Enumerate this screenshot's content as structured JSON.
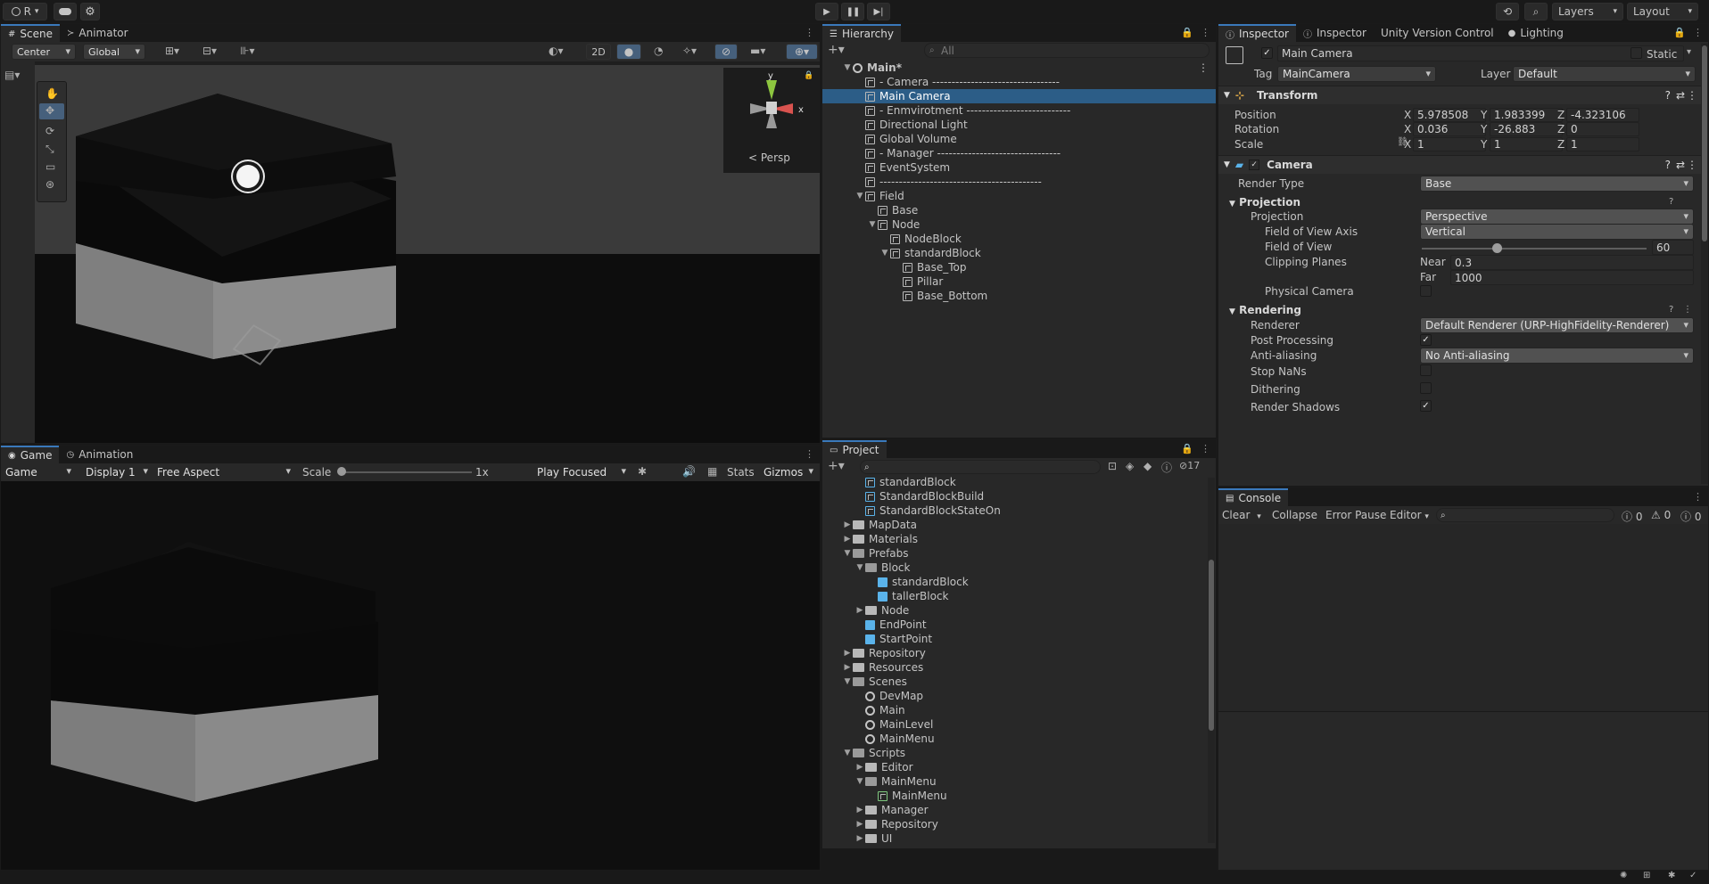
{
  "toolbar": {
    "account_label": "R",
    "layers_label": "Layers",
    "layout_label": "Layout"
  },
  "scene_panel": {
    "tabs": [
      "Scene",
      "Animator"
    ],
    "pivot": "Center",
    "space": "Global",
    "mode_2d": "2D",
    "persp_label": "Persp"
  },
  "game_panel": {
    "tabs": [
      "Game",
      "Animation"
    ],
    "view": "Game",
    "display": "Display 1",
    "aspect": "Free Aspect",
    "scale_label": "Scale",
    "scale_value": "1x",
    "play_mode": "Play Focused",
    "stats": "Stats",
    "gizmos": "Gizmos"
  },
  "hierarchy": {
    "tab": "Hierarchy",
    "search_placeholder": "All",
    "items": [
      {
        "label": "Main*",
        "indent": 0,
        "type": "scene",
        "expanded": true
      },
      {
        "label": "- Camera ---------------------------------",
        "indent": 1,
        "type": "go"
      },
      {
        "label": "Main Camera",
        "indent": 1,
        "type": "go",
        "selected": true
      },
      {
        "label": "- Enmvirotment ---------------------------",
        "indent": 1,
        "type": "go"
      },
      {
        "label": "Directional Light",
        "indent": 1,
        "type": "go"
      },
      {
        "label": "Global Volume",
        "indent": 1,
        "type": "go"
      },
      {
        "label": "- Manager --------------------------------",
        "indent": 1,
        "type": "go"
      },
      {
        "label": "EventSystem",
        "indent": 1,
        "type": "go"
      },
      {
        "label": "------------------------------------------",
        "indent": 1,
        "type": "go"
      },
      {
        "label": "Field",
        "indent": 1,
        "type": "go",
        "expanded": true
      },
      {
        "label": "Base",
        "indent": 2,
        "type": "go"
      },
      {
        "label": "Node",
        "indent": 2,
        "type": "go",
        "expanded": true
      },
      {
        "label": "NodeBlock",
        "indent": 3,
        "type": "go"
      },
      {
        "label": "standardBlock",
        "indent": 3,
        "type": "go",
        "expanded": true
      },
      {
        "label": "Base_Top",
        "indent": 4,
        "type": "go"
      },
      {
        "label": "Pillar",
        "indent": 4,
        "type": "go"
      },
      {
        "label": "Base_Bottom",
        "indent": 4,
        "type": "go"
      }
    ]
  },
  "project": {
    "tab": "Project",
    "hidden_count": "17",
    "items": [
      {
        "label": "standardBlock",
        "indent": 2,
        "type": "asset"
      },
      {
        "label": "StandardBlockBuild",
        "indent": 2,
        "type": "asset"
      },
      {
        "label": "StandardBlockStateOn",
        "indent": 2,
        "type": "asset"
      },
      {
        "label": "MapData",
        "indent": 1,
        "type": "folder",
        "arrow": "right"
      },
      {
        "label": "Materials",
        "indent": 1,
        "type": "folder",
        "arrow": "right"
      },
      {
        "label": "Prefabs",
        "indent": 1,
        "type": "folder-open",
        "arrow": "down"
      },
      {
        "label": "Block",
        "indent": 2,
        "type": "folder-open",
        "arrow": "down"
      },
      {
        "label": "standardBlock",
        "indent": 3,
        "type": "prefab"
      },
      {
        "label": "tallerBlock",
        "indent": 3,
        "type": "prefab"
      },
      {
        "label": "Node",
        "indent": 2,
        "type": "folder",
        "arrow": "right"
      },
      {
        "label": "EndPoint",
        "indent": 2,
        "type": "prefab"
      },
      {
        "label": "StartPoint",
        "indent": 2,
        "type": "prefab"
      },
      {
        "label": "Repository",
        "indent": 1,
        "type": "folder",
        "arrow": "right"
      },
      {
        "label": "Resources",
        "indent": 1,
        "type": "folder",
        "arrow": "right"
      },
      {
        "label": "Scenes",
        "indent": 1,
        "type": "folder-open",
        "arrow": "down"
      },
      {
        "label": "DevMap",
        "indent": 2,
        "type": "scene"
      },
      {
        "label": "Main",
        "indent": 2,
        "type": "scene"
      },
      {
        "label": "MainLevel",
        "indent": 2,
        "type": "scene"
      },
      {
        "label": "MainMenu",
        "indent": 2,
        "type": "scene"
      },
      {
        "label": "Scripts",
        "indent": 1,
        "type": "folder-open",
        "arrow": "down"
      },
      {
        "label": "Editor",
        "indent": 2,
        "type": "folder",
        "arrow": "right"
      },
      {
        "label": "MainMenu",
        "indent": 2,
        "type": "folder-open",
        "arrow": "down"
      },
      {
        "label": "MainMenu",
        "indent": 3,
        "type": "script"
      },
      {
        "label": "Manager",
        "indent": 2,
        "type": "folder",
        "arrow": "right"
      },
      {
        "label": "Repository",
        "indent": 2,
        "type": "folder",
        "arrow": "right"
      },
      {
        "label": "UI",
        "indent": 2,
        "type": "folder",
        "arrow": "right"
      }
    ]
  },
  "inspector": {
    "tabs": [
      "Inspector",
      "Inspector",
      "Unity Version Control",
      "Lighting"
    ],
    "object_name": "Main Camera",
    "static_label": "Static",
    "tag_label": "Tag",
    "tag_value": "MainCamera",
    "layer_label": "Layer",
    "layer_value": "Default",
    "transform": {
      "title": "Transform",
      "position_label": "Position",
      "rotation_label": "Rotation",
      "scale_label": "Scale",
      "position": {
        "x": "5.978508",
        "y": "1.983399",
        "z": "-4.323106"
      },
      "rotation": {
        "x": "0.036",
        "y": "-26.883",
        "z": "0"
      },
      "scale": {
        "x": "1",
        "y": "1",
        "z": "1"
      }
    },
    "camera": {
      "title": "Camera",
      "render_type_label": "Render Type",
      "render_type": "Base",
      "projection_section": "Projection",
      "projection_label": "Projection",
      "projection": "Perspective",
      "fov_axis_label": "Field of View Axis",
      "fov_axis": "Vertical",
      "fov_label": "Field of View",
      "fov_value": "60",
      "fov_min": 1,
      "fov_max": 179,
      "clip_label": "Clipping Planes",
      "near_label": "Near",
      "near_value": "0.3",
      "far_label": "Far",
      "far_value": "1000",
      "physical_label": "Physical Camera",
      "rendering_section": "Rendering",
      "renderer_label": "Renderer",
      "renderer": "Default Renderer (URP-HighFidelity-Renderer)",
      "post_label": "Post Processing",
      "aa_label": "Anti-aliasing",
      "aa_value": "No Anti-aliasing",
      "nan_label": "Stop NaNs",
      "dither_label": "Dithering",
      "shadows_label": "Render Shadows"
    }
  },
  "console": {
    "tab": "Console",
    "clear": "Clear",
    "collapse": "Collapse",
    "error_pause": "Error Pause",
    "editor": "Editor",
    "log_count": "0",
    "warn_count": "0",
    "error_count": "0"
  },
  "colors": {
    "accent": "#3a79bb",
    "selection": "#2c5d87",
    "panel_bg": "#282828",
    "prefab_blue": "#5ab3ea"
  }
}
